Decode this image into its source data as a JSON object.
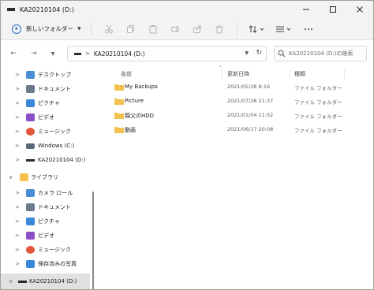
{
  "window": {
    "title": "KA20210104 (D:)"
  },
  "toolbar": {
    "new_label": "新しいフォルダー"
  },
  "address": {
    "path": "KA20210104 (D:)"
  },
  "search": {
    "placeholder": "KA20210104 (D:)の検索"
  },
  "columns": {
    "name": "名前",
    "date": "更新日時",
    "type": "種類"
  },
  "files": [
    {
      "name": "My Backups",
      "date": "2021/05/28 8:16",
      "type": "ファイル フォルダー"
    },
    {
      "name": "Picture",
      "date": "2021/07/26 21:37",
      "type": "ファイル フォルダー"
    },
    {
      "name": "親父のHDD",
      "date": "2021/01/04 11:52",
      "type": "ファイル フォルダー"
    },
    {
      "name": "動画",
      "date": "2021/06/17 20:08",
      "type": "ファイル フォルダー"
    }
  ],
  "sidebar": {
    "items": [
      {
        "label": "デスクトップ",
        "icon": "desktop-icon"
      },
      {
        "label": "ドキュメント",
        "icon": "documents-icon"
      },
      {
        "label": "ピクチャ",
        "icon": "pictures-icon"
      },
      {
        "label": "ビデオ",
        "icon": "videos-icon"
      },
      {
        "label": "ミュージック",
        "icon": "music-icon"
      },
      {
        "label": "Windows (C:)",
        "icon": "windows-drive-icon"
      },
      {
        "label": "KA20210104 (D:)",
        "icon": "drive-icon"
      },
      {
        "label": "ライブラリ",
        "icon": "library-folder-icon"
      },
      {
        "label": "カメラ ロール",
        "icon": "camera-roll-icon"
      },
      {
        "label": "ドキュメント",
        "icon": "documents-icon"
      },
      {
        "label": "ピクチャ",
        "icon": "pictures-icon"
      },
      {
        "label": "ビデオ",
        "icon": "videos-icon"
      },
      {
        "label": "ミュージック",
        "icon": "music-icon"
      },
      {
        "label": "保存済みの写真",
        "icon": "saved-pictures-icon"
      },
      {
        "label": "KA20210104 (D:)",
        "icon": "drive-icon"
      }
    ]
  },
  "colors": {
    "accent": "#2d6fbf",
    "folder": "#f2c14e",
    "selection": "#e0e0e0"
  }
}
